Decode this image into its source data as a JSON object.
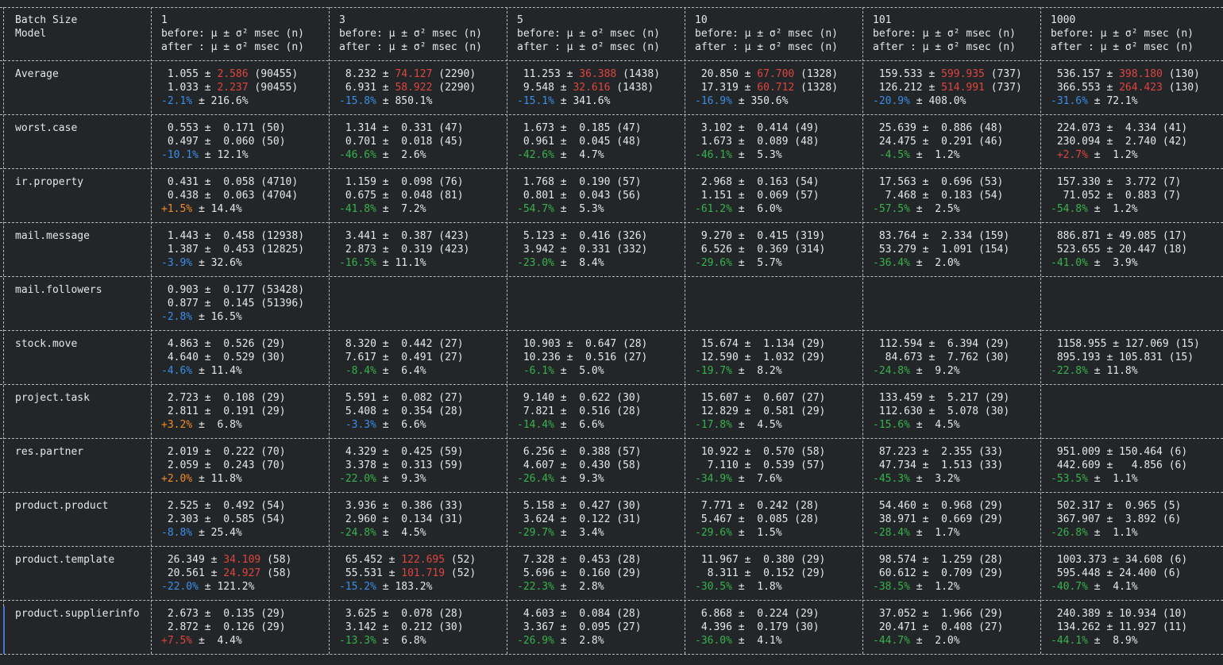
{
  "header": {
    "col0": [
      "Batch Size",
      "Model",
      ""
    ],
    "batches": [
      "1",
      "3",
      "5",
      "10",
      "101",
      "1000"
    ],
    "before_label": "before: μ ± σ² msec (n)",
    "after_label": "after : μ ± σ² msec (n)"
  },
  "colors": {
    "red": "#e0443e",
    "green": "#37b24d",
    "blue": "#3a8ee6",
    "orange": "#f08c2a"
  },
  "rows": [
    {
      "model": "Average",
      "cells": [
        {
          "b": "1.055 ± ",
          "bs": "2.586",
          "bn": " (90455)",
          "a": "1.033 ± ",
          "as": "2.237",
          "an": " (90455)",
          "d": "-2.1%",
          "dc": "blue",
          "v": " ± 216.6%",
          "sc": "red"
        },
        {
          "b": "8.232 ± ",
          "bs": "74.127",
          "bn": " (2290)",
          "a": "6.931 ± ",
          "as": "58.922",
          "an": " (2290)",
          "d": "-15.8%",
          "dc": "blue",
          "v": " ± 850.1%",
          "sc": "red"
        },
        {
          "b": "11.253 ± ",
          "bs": "36.388",
          "bn": " (1438)",
          "a": "9.548 ± ",
          "as": "32.616",
          "an": " (1438)",
          "d": "-15.1%",
          "dc": "blue",
          "v": " ± 341.6%",
          "sc": "red"
        },
        {
          "b": "20.850 ± ",
          "bs": "67.700",
          "bn": " (1328)",
          "a": "17.319 ± ",
          "as": "60.712",
          "an": " (1328)",
          "d": "-16.9%",
          "dc": "blue",
          "v": " ± 350.6%",
          "sc": "red"
        },
        {
          "b": "159.533 ± ",
          "bs": "599.935",
          "bn": " (737)",
          "a": "126.212 ± ",
          "as": "514.991",
          "an": " (737)",
          "d": "-20.9%",
          "dc": "blue",
          "v": " ± 408.0%",
          "sc": "red"
        },
        {
          "b": "536.157 ± ",
          "bs": "398.180",
          "bn": " (130)",
          "a": "366.553 ± ",
          "as": "264.423",
          "an": " (130)",
          "d": "-31.6%",
          "dc": "blue",
          "v": " ± 72.1%",
          "sc": "red"
        }
      ]
    },
    {
      "model": "worst.case",
      "cells": [
        {
          "b": "0.553 ± ",
          "bs": " 0.171",
          "bn": " (50)",
          "a": "0.497 ± ",
          "as": " 0.060",
          "an": " (50)",
          "d": "-10.1%",
          "dc": "blue",
          "v": " ± 12.1%"
        },
        {
          "b": "1.314 ± ",
          "bs": " 0.331",
          "bn": " (47)",
          "a": "0.701 ± ",
          "as": " 0.018",
          "an": " (45)",
          "d": "-46.6%",
          "dc": "green",
          "v": " ±  2.6%"
        },
        {
          "b": "1.673 ± ",
          "bs": " 0.185",
          "bn": " (47)",
          "a": "0.961 ± ",
          "as": " 0.045",
          "an": " (48)",
          "d": "-42.6%",
          "dc": "green",
          "v": " ±  4.7%"
        },
        {
          "b": "3.102 ± ",
          "bs": " 0.414",
          "bn": " (49)",
          "a": "1.673 ± ",
          "as": " 0.089",
          "an": " (48)",
          "d": "-46.1%",
          "dc": "green",
          "v": " ±  5.3%"
        },
        {
          "b": "25.639 ± ",
          "bs": " 0.886",
          "bn": " (48)",
          "a": "24.475 ± ",
          "as": " 0.291",
          "an": " (46)",
          "d": " -4.5%",
          "dc": "green",
          "v": " ±  1.2%"
        },
        {
          "b": "224.073 ± ",
          "bs": " 4.334",
          "bn": " (41)",
          "a": "230.094 ± ",
          "as": " 2.740",
          "an": " (42)",
          "d": " +2.7%",
          "dc": "red",
          "v": " ±  1.2%"
        }
      ]
    },
    {
      "model": "ir.property",
      "cells": [
        {
          "b": "0.431 ± ",
          "bs": " 0.058",
          "bn": " (4710)",
          "a": "0.438 ± ",
          "as": " 0.063",
          "an": " (4704)",
          "d": "+1.5%",
          "dc": "orange",
          "v": " ± 14.4%"
        },
        {
          "b": "1.159 ± ",
          "bs": " 0.098",
          "bn": " (76)",
          "a": "0.675 ± ",
          "as": " 0.048",
          "an": " (81)",
          "d": "-41.8%",
          "dc": "green",
          "v": " ±  7.2%"
        },
        {
          "b": "1.768 ± ",
          "bs": " 0.190",
          "bn": " (57)",
          "a": "0.801 ± ",
          "as": " 0.043",
          "an": " (56)",
          "d": "-54.7%",
          "dc": "green",
          "v": " ±  5.3%"
        },
        {
          "b": "2.968 ± ",
          "bs": " 0.163",
          "bn": " (54)",
          "a": "1.151 ± ",
          "as": " 0.069",
          "an": " (57)",
          "d": "-61.2%",
          "dc": "green",
          "v": " ±  6.0%"
        },
        {
          "b": "17.563 ± ",
          "bs": " 0.696",
          "bn": " (53)",
          "a": " 7.468 ± ",
          "as": " 0.183",
          "an": " (54)",
          "d": "-57.5%",
          "dc": "green",
          "v": " ±  2.5%"
        },
        {
          "b": "157.330 ± ",
          "bs": " 3.772",
          "bn": " (7)",
          "a": " 71.052 ± ",
          "as": " 0.883",
          "an": " (7)",
          "d": "-54.8%",
          "dc": "green",
          "v": " ±  1.2%"
        }
      ]
    },
    {
      "model": "mail.message",
      "cells": [
        {
          "b": "1.443 ± ",
          "bs": " 0.458",
          "bn": " (12938)",
          "a": "1.387 ± ",
          "as": " 0.453",
          "an": " (12825)",
          "d": "-3.9%",
          "dc": "blue",
          "v": " ± 32.6%"
        },
        {
          "b": "3.441 ± ",
          "bs": " 0.387",
          "bn": " (423)",
          "a": "2.873 ± ",
          "as": " 0.319",
          "an": " (423)",
          "d": "-16.5%",
          "dc": "green",
          "v": " ± 11.1%"
        },
        {
          "b": "5.123 ± ",
          "bs": " 0.416",
          "bn": " (326)",
          "a": "3.942 ± ",
          "as": " 0.331",
          "an": " (332)",
          "d": "-23.0%",
          "dc": "green",
          "v": " ±  8.4%"
        },
        {
          "b": "9.270 ± ",
          "bs": " 0.415",
          "bn": " (319)",
          "a": "6.526 ± ",
          "as": " 0.369",
          "an": " (314)",
          "d": "-29.6%",
          "dc": "green",
          "v": " ±  5.7%"
        },
        {
          "b": "83.764 ± ",
          "bs": " 2.334",
          "bn": " (159)",
          "a": "53.279 ± ",
          "as": " 1.091",
          "an": " (154)",
          "d": "-36.4%",
          "dc": "green",
          "v": " ±  2.0%"
        },
        {
          "b": "886.871 ± ",
          "bs": "49.085",
          "bn": " (17)",
          "a": "523.655 ± ",
          "as": "20.447",
          "an": " (18)",
          "d": "-41.0%",
          "dc": "green",
          "v": " ±  3.9%"
        }
      ]
    },
    {
      "model": "mail.followers",
      "cells": [
        {
          "b": "0.903 ± ",
          "bs": " 0.177",
          "bn": " (53428)",
          "a": "0.877 ± ",
          "as": " 0.145",
          "an": " (51396)",
          "d": "-2.8%",
          "dc": "blue",
          "v": " ± 16.5%"
        },
        null,
        null,
        null,
        null,
        null
      ]
    },
    {
      "model": "stock.move",
      "cells": [
        {
          "b": "4.863 ± ",
          "bs": " 0.526",
          "bn": " (29)",
          "a": "4.640 ± ",
          "as": " 0.529",
          "an": " (30)",
          "d": "-4.6%",
          "dc": "blue",
          "v": " ± 11.4%"
        },
        {
          "b": "8.320 ± ",
          "bs": " 0.442",
          "bn": " (27)",
          "a": "7.617 ± ",
          "as": " 0.491",
          "an": " (27)",
          "d": " -8.4%",
          "dc": "green",
          "v": " ±  6.4%"
        },
        {
          "b": "10.903 ± ",
          "bs": " 0.647",
          "bn": " (28)",
          "a": "10.236 ± ",
          "as": " 0.516",
          "an": " (27)",
          "d": " -6.1%",
          "dc": "green",
          "v": " ±  5.0%"
        },
        {
          "b": "15.674 ± ",
          "bs": " 1.134",
          "bn": " (29)",
          "a": "12.590 ± ",
          "as": " 1.032",
          "an": " (29)",
          "d": "-19.7%",
          "dc": "green",
          "v": " ±  8.2%"
        },
        {
          "b": "112.594 ± ",
          "bs": " 6.394",
          "bn": " (29)",
          "a": " 84.673 ± ",
          "as": " 7.762",
          "an": " (30)",
          "d": "-24.8%",
          "dc": "green",
          "v": " ±  9.2%"
        },
        {
          "b": "1158.955 ± ",
          "bs": "127.069",
          "bn": " (15)",
          "a": "895.193 ± ",
          "as": "105.831",
          "an": " (15)",
          "d": "-22.8%",
          "dc": "green",
          "v": " ± 11.8%"
        }
      ]
    },
    {
      "model": "project.task",
      "cells": [
        {
          "b": "2.723 ± ",
          "bs": " 0.108",
          "bn": " (29)",
          "a": "2.811 ± ",
          "as": " 0.191",
          "an": " (29)",
          "d": "+3.2%",
          "dc": "orange",
          "v": " ±  6.8%"
        },
        {
          "b": "5.591 ± ",
          "bs": " 0.082",
          "bn": " (27)",
          "a": "5.408 ± ",
          "as": " 0.354",
          "an": " (28)",
          "d": " -3.3%",
          "dc": "blue",
          "v": " ±  6.6%"
        },
        {
          "b": "9.140 ± ",
          "bs": " 0.622",
          "bn": " (30)",
          "a": "7.821 ± ",
          "as": " 0.516",
          "an": " (28)",
          "d": "-14.4%",
          "dc": "green",
          "v": " ±  6.6%"
        },
        {
          "b": "15.607 ± ",
          "bs": " 0.607",
          "bn": " (27)",
          "a": "12.829 ± ",
          "as": " 0.581",
          "an": " (29)",
          "d": "-17.8%",
          "dc": "green",
          "v": " ±  4.5%"
        },
        {
          "b": "133.459 ± ",
          "bs": " 5.217",
          "bn": " (29)",
          "a": "112.630 ± ",
          "as": " 5.078",
          "an": " (30)",
          "d": "-15.6%",
          "dc": "green",
          "v": " ±  4.5%"
        },
        null
      ]
    },
    {
      "model": "res.partner",
      "cells": [
        {
          "b": "2.019 ± ",
          "bs": " 0.222",
          "bn": " (70)",
          "a": "2.059 ± ",
          "as": " 0.243",
          "an": " (70)",
          "d": "+2.0%",
          "dc": "orange",
          "v": " ± 11.8%"
        },
        {
          "b": "4.329 ± ",
          "bs": " 0.425",
          "bn": " (59)",
          "a": "3.378 ± ",
          "as": " 0.313",
          "an": " (59)",
          "d": "-22.0%",
          "dc": "green",
          "v": " ±  9.3%"
        },
        {
          "b": "6.256 ± ",
          "bs": " 0.388",
          "bn": " (57)",
          "a": "4.607 ± ",
          "as": " 0.430",
          "an": " (58)",
          "d": "-26.4%",
          "dc": "green",
          "v": " ±  9.3%"
        },
        {
          "b": "10.922 ± ",
          "bs": " 0.570",
          "bn": " (58)",
          "a": " 7.110 ± ",
          "as": " 0.539",
          "an": " (57)",
          "d": "-34.9%",
          "dc": "green",
          "v": " ±  7.6%"
        },
        {
          "b": "87.223 ± ",
          "bs": " 2.355",
          "bn": " (33)",
          "a": "47.734 ± ",
          "as": " 1.513",
          "an": " (33)",
          "d": "-45.3%",
          "dc": "green",
          "v": " ±  3.2%"
        },
        {
          "b": "951.009 ± ",
          "bs": "150.464",
          "bn": " (6)",
          "a": "442.609 ± ",
          "as": "  4.856",
          "an": " (6)",
          "d": "-53.5%",
          "dc": "green",
          "v": " ±  1.1%"
        }
      ]
    },
    {
      "model": "product.product",
      "cells": [
        {
          "b": "2.525 ± ",
          "bs": " 0.492",
          "bn": " (54)",
          "a": "2.303 ± ",
          "as": " 0.585",
          "an": " (54)",
          "d": "-8.8%",
          "dc": "blue",
          "v": " ± 25.4%"
        },
        {
          "b": "3.936 ± ",
          "bs": " 0.386",
          "bn": " (33)",
          "a": "2.960 ± ",
          "as": " 0.134",
          "an": " (31)",
          "d": "-24.8%",
          "dc": "green",
          "v": " ±  4.5%"
        },
        {
          "b": "5.158 ± ",
          "bs": " 0.427",
          "bn": " (30)",
          "a": "3.624 ± ",
          "as": " 0.122",
          "an": " (31)",
          "d": "-29.7%",
          "dc": "green",
          "v": " ±  3.4%"
        },
        {
          "b": "7.771 ± ",
          "bs": " 0.242",
          "bn": " (28)",
          "a": "5.467 ± ",
          "as": " 0.085",
          "an": " (28)",
          "d": "-29.6%",
          "dc": "green",
          "v": " ±  1.5%"
        },
        {
          "b": "54.460 ± ",
          "bs": " 0.968",
          "bn": " (29)",
          "a": "38.971 ± ",
          "as": " 0.669",
          "an": " (29)",
          "d": "-28.4%",
          "dc": "green",
          "v": " ±  1.7%"
        },
        {
          "b": "502.317 ± ",
          "bs": " 0.965",
          "bn": " (5)",
          "a": "367.907 ± ",
          "as": " 3.892",
          "an": " (6)",
          "d": "-26.8%",
          "dc": "green",
          "v": " ±  1.1%"
        }
      ]
    },
    {
      "model": "product.template",
      "cells": [
        {
          "b": "26.349 ± ",
          "bs": "34.109",
          "bn": " (58)",
          "a": "20.561 ± ",
          "as": "24.927",
          "an": " (58)",
          "d": "-22.0%",
          "dc": "blue",
          "v": " ± 121.2%",
          "sc": "red"
        },
        {
          "b": "65.452 ± ",
          "bs": "122.695",
          "bn": " (52)",
          "a": "55.531 ± ",
          "as": "101.719",
          "an": " (52)",
          "d": "-15.2%",
          "dc": "blue",
          "v": " ± 183.2%",
          "sc": "red"
        },
        {
          "b": "7.328 ± ",
          "bs": " 0.453",
          "bn": " (28)",
          "a": "5.696 ± ",
          "as": " 0.160",
          "an": " (29)",
          "d": "-22.3%",
          "dc": "green",
          "v": " ±  2.8%"
        },
        {
          "b": "11.967 ± ",
          "bs": " 0.380",
          "bn": " (29)",
          "a": " 8.311 ± ",
          "as": " 0.152",
          "an": " (29)",
          "d": "-30.5%",
          "dc": "green",
          "v": " ±  1.8%"
        },
        {
          "b": "98.574 ± ",
          "bs": " 1.259",
          "bn": " (28)",
          "a": "60.612 ± ",
          "as": " 0.709",
          "an": " (29)",
          "d": "-38.5%",
          "dc": "green",
          "v": " ±  1.2%"
        },
        {
          "b": "1003.373 ± ",
          "bs": "34.608",
          "bn": " (6)",
          "a": "595.448 ± ",
          "as": "24.400",
          "an": " (6)",
          "d": "-40.7%",
          "dc": "green",
          "v": " ±  4.1%"
        }
      ]
    },
    {
      "model": "product.supplierinfo",
      "cells": [
        {
          "b": "2.673 ± ",
          "bs": " 0.135",
          "bn": " (29)",
          "a": "2.872 ± ",
          "as": " 0.126",
          "an": " (29)",
          "d": "+7.5%",
          "dc": "red",
          "v": " ±  4.4%"
        },
        {
          "b": "3.625 ± ",
          "bs": " 0.078",
          "bn": " (28)",
          "a": "3.142 ± ",
          "as": " 0.212",
          "an": " (30)",
          "d": "-13.3%",
          "dc": "green",
          "v": " ±  6.8%"
        },
        {
          "b": "4.603 ± ",
          "bs": " 0.084",
          "bn": " (28)",
          "a": "3.367 ± ",
          "as": " 0.095",
          "an": " (27)",
          "d": "-26.9%",
          "dc": "green",
          "v": " ±  2.8%"
        },
        {
          "b": "6.868 ± ",
          "bs": " 0.224",
          "bn": " (29)",
          "a": "4.396 ± ",
          "as": " 0.179",
          "an": " (30)",
          "d": "-36.0%",
          "dc": "green",
          "v": " ±  4.1%"
        },
        {
          "b": "37.052 ± ",
          "bs": " 1.966",
          "bn": " (29)",
          "a": "20.471 ± ",
          "as": " 0.408",
          "an": " (27)",
          "d": "-44.7%",
          "dc": "green",
          "v": " ±  2.0%"
        },
        {
          "b": "240.389 ± ",
          "bs": "10.934",
          "bn": " (10)",
          "a": "134.262 ± ",
          "as": "11.927",
          "an": " (11)",
          "d": "-44.1%",
          "dc": "green",
          "v": " ±  8.9%"
        }
      ]
    }
  ]
}
